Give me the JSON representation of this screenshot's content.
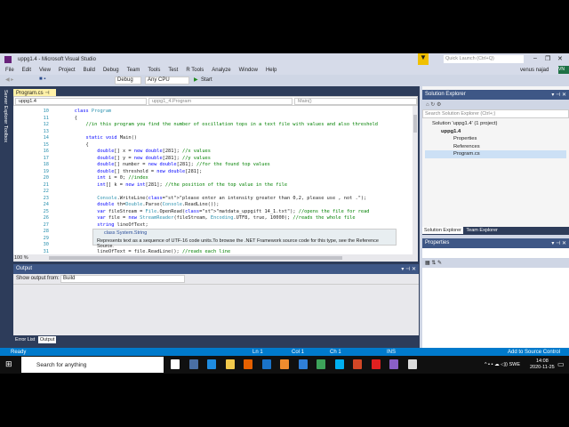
{
  "window": {
    "title": "uppg1.4 - Microsoft Visual Studio",
    "quick_launch_placeholder": "Quick Launch (Ctrl+Q)",
    "user": "venus najad",
    "user_initials": "VN"
  },
  "menu": [
    "File",
    "Edit",
    "View",
    "Project",
    "Build",
    "Debug",
    "Team",
    "Tools",
    "Test",
    "R Tools",
    "Analyze",
    "Window",
    "Help"
  ],
  "toolbar": {
    "config": "Debug",
    "platform": "Any CPU",
    "start": "Start"
  },
  "side_tabs": [
    "Server Explorer",
    "Toolbox"
  ],
  "editor": {
    "tab": "Program.cs",
    "nav_project": "uppg1.4",
    "nav_class": "uppg1_4.Program",
    "nav_member": "Main()",
    "zoom": "100 %",
    "lines": [
      {
        "n": "10",
        "t": "    class Program"
      },
      {
        "n": "11",
        "t": "    {"
      },
      {
        "n": "12",
        "t": "        //in this program you find the number of oscillation tops in a text file with values and also threshold"
      },
      {
        "n": "13",
        "t": ""
      },
      {
        "n": "14",
        "t": "        static void Main()"
      },
      {
        "n": "15",
        "t": "        {"
      },
      {
        "n": "16",
        "t": "            double[] x = new double[281]; //x values"
      },
      {
        "n": "17",
        "t": "            double[] y = new double[281]; //y values"
      },
      {
        "n": "18",
        "t": "            double[] number = new double[281]; //for the found top values"
      },
      {
        "n": "19",
        "t": "            double[] threshold = new double[281];"
      },
      {
        "n": "20",
        "t": "            int i = 0; //index"
      },
      {
        "n": "21",
        "t": "            int[] k = new int[281]; //the position of the top value in the file"
      },
      {
        "n": "22",
        "t": ""
      },
      {
        "n": "23",
        "t": "            Console.WriteLine(\"please enter an intensity greater than 0,2, please use , not .\");"
      },
      {
        "n": "24",
        "t": "            double th=Double.Parse(Console.ReadLine());"
      },
      {
        "n": "25",
        "t": "            var fileStream = File.OpenRead(\"matdata_uppgift 14_1.txt\"); //opens the file for read"
      },
      {
        "n": "26",
        "t": "            var file = new StreamReader(fileStream, Encoding.UTF8, true, 10000); //reads the whole file"
      },
      {
        "n": "27",
        "t": "            string lineOfText;"
      },
      {
        "n": "28",
        "t": ""
      },
      {
        "n": "29",
        "t": "            Co"
      },
      {
        "n": "30",
        "t": "            Co"
      },
      {
        "n": "31",
        "t": "            lineOfText = file.ReadLine(); //reads each line"
      }
    ],
    "tooltip_title": "class System.String",
    "tooltip_body": "Represents text as a sequence of UTF-16 code units.To browse the .NET Framework source code for this type, see the Reference Source."
  },
  "output": {
    "title": "Output",
    "show_from_label": "Show output from:",
    "source": "Build",
    "tabs": [
      "Error List",
      "Output"
    ]
  },
  "solution_explorer": {
    "title": "Solution Explorer",
    "search_placeholder": "Search Solution Explorer (Ctrl+;)",
    "tree": [
      "Solution 'uppg1.4' (1 project)",
      "uppg1.4",
      "Properties",
      "References",
      "Program.cs"
    ],
    "tabs": [
      "Solution Explorer",
      "Team Explorer"
    ]
  },
  "properties": {
    "title": "Properties"
  },
  "status": {
    "ready": "Ready",
    "ln": "Ln 1",
    "col": "Col 1",
    "ch": "Ch 1",
    "mode": "INS",
    "source_control": "Add to Source Control"
  },
  "taskbar": {
    "search_placeholder": "Search for anything",
    "lang": "SWE",
    "time": "14:08",
    "date": "2020-11-25",
    "apps": [
      {
        "name": "task-view",
        "color": "#ffffff"
      },
      {
        "name": "calculator",
        "color": "#4a6fa5"
      },
      {
        "name": "edge",
        "color": "#1f8ce0"
      },
      {
        "name": "file-explorer",
        "color": "#f2c94c"
      },
      {
        "name": "firefox",
        "color": "#e66000"
      },
      {
        "name": "app",
        "color": "#1a73c9"
      },
      {
        "name": "media",
        "color": "#f08c2e"
      },
      {
        "name": "mail",
        "color": "#2f7fd8"
      },
      {
        "name": "chrome",
        "color": "#3da35a"
      },
      {
        "name": "skype",
        "color": "#00aff0"
      },
      {
        "name": "powerpoint",
        "color": "#d24726"
      },
      {
        "name": "acrobat",
        "color": "#e02020"
      },
      {
        "name": "visual-studio",
        "color": "#8a5fc7"
      },
      {
        "name": "window",
        "color": "#dddddd"
      }
    ]
  }
}
